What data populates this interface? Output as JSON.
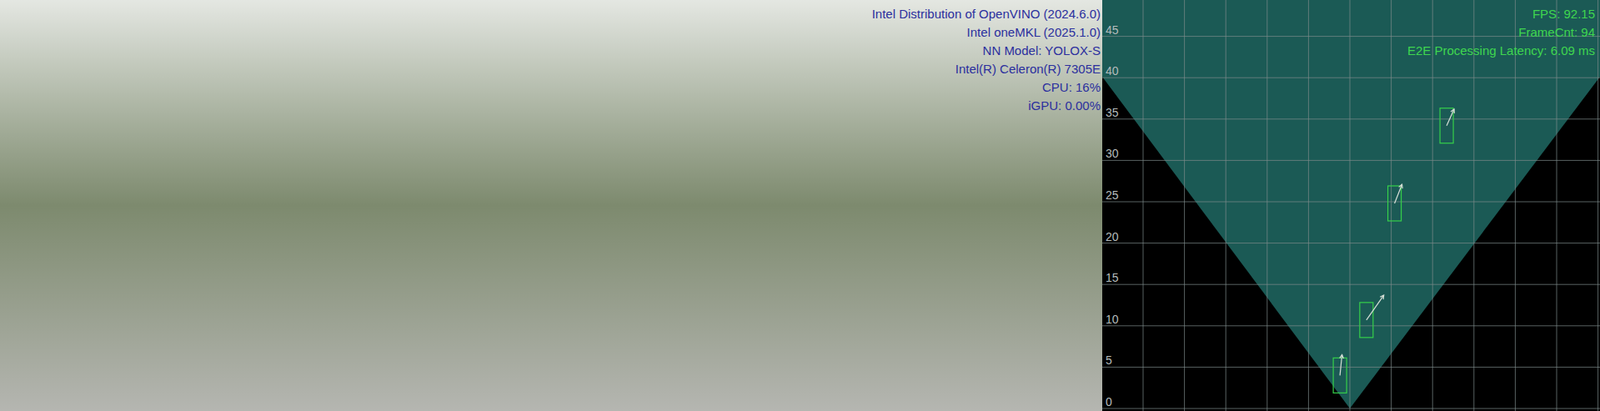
{
  "camera_views": [
    {
      "name": "raw-frame"
    },
    {
      "name": "annotated-frame"
    }
  ],
  "overlay_info": [
    "Intel Distribution of OpenVINO (2024.6.0)",
    "Intel oneMKL (2025.1.0)",
    "NN Model: YOLOX-S",
    "Intel(R) Celeron(R) 7305E",
    "CPU: 16%",
    "iGPU: 0.00%"
  ],
  "bird_view": {
    "stats": [
      "FPS: 92.15",
      "FrameCnt: 94",
      "E2E Processing Latency: 6.09 ms"
    ],
    "y_ticks": [
      "0",
      "5",
      "10",
      "15",
      "20",
      "25",
      "30",
      "35",
      "40",
      "45"
    ],
    "objects": [
      {
        "x": -1.2,
        "y": 4.0,
        "vx": 0.25,
        "vy": 2.5
      },
      {
        "x": 2.0,
        "y": 10.7,
        "vx": 2.1,
        "vy": 3.0
      },
      {
        "x": 5.4,
        "y": 24.8,
        "vx": 0.9,
        "vy": 2.3
      },
      {
        "x": 11.7,
        "y": 34.2,
        "vx": 0.9,
        "vy": 2.0
      }
    ]
  }
}
